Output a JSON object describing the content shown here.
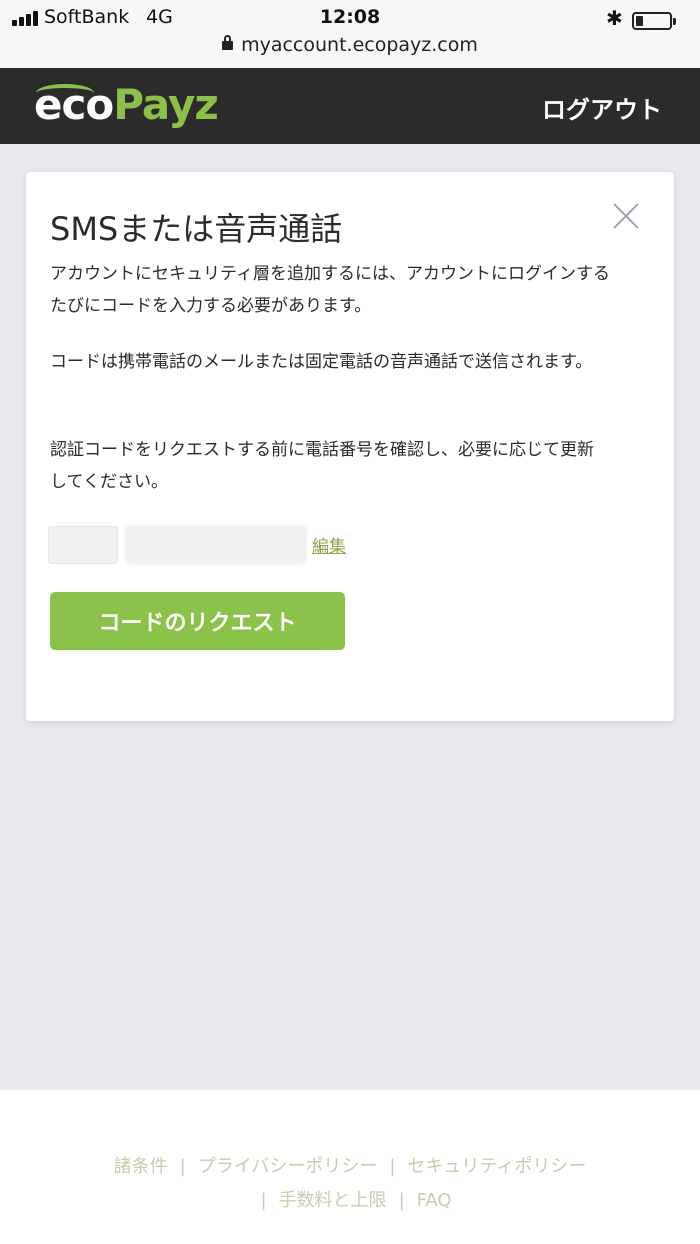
{
  "status_bar": {
    "carrier": "SoftBank",
    "network": "4G",
    "time": "12:08",
    "bluetooth_icon": "bluetooth-icon",
    "battery_icon": "battery-icon",
    "url": "myaccount.ecopayz.com"
  },
  "header": {
    "logo_eco": "eco",
    "logo_payz": "Payz",
    "logout": "ログアウト",
    "colors": {
      "background": "#2b2b2b",
      "brand_green": "#8cc04a"
    }
  },
  "modal": {
    "title": "SMSまたは音声通話",
    "para1": "アカウントにセキュリティ層を追加するには、アカウントにログインするたびにコードを入力する必要があります。",
    "para2": "コードは携帯電話のメールまたは固定電話の音声通話で送信されます。",
    "para3": "認証コードをリクエストする前に電話番号を確認し、必要に応じて更新してください。",
    "phone_code": "",
    "phone_number": "",
    "edit_link": "編集",
    "request_button": "コードのリクエスト",
    "button_color": "#8bc34a"
  },
  "footer": {
    "links": [
      "諸条件",
      "プライバシーポリシー",
      "セキュリティポリシー",
      "手数料と上限",
      "FAQ"
    ],
    "separator": "|"
  }
}
